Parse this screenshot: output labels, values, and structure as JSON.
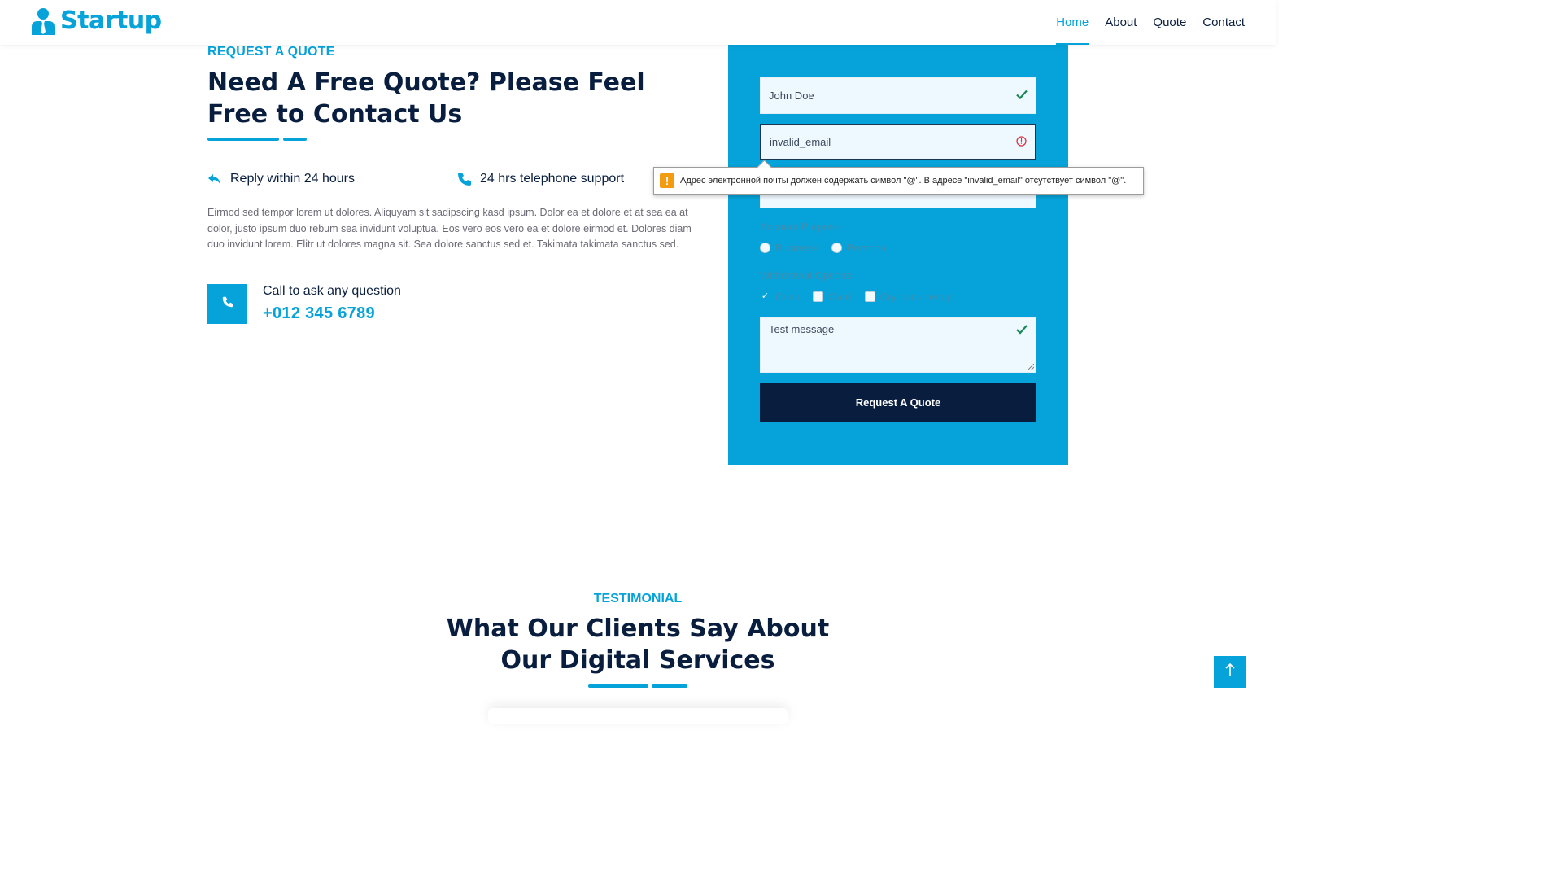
{
  "colors": {
    "primary": "#06a3da",
    "dark": "#091e3e",
    "form_bg": "#06a3da",
    "warning": "#f39c12",
    "valid": "#198754",
    "invalid": "#dc3545"
  },
  "brand": {
    "name": "Startup",
    "icon": "user-tie-icon"
  },
  "nav": {
    "items": [
      {
        "label": "Home",
        "active": true
      },
      {
        "label": "About",
        "active": false
      },
      {
        "label": "Quote",
        "active": false
      },
      {
        "label": "Contact",
        "active": false
      }
    ]
  },
  "quote": {
    "subtitle": "REQUEST A QUOTE",
    "heading": "Need A Free Quote? Please Feel Free to Contact Us",
    "features": [
      {
        "icon": "reply-icon",
        "label": "Reply within 24 hours"
      },
      {
        "icon": "phone-icon",
        "label": "24 hrs telephone support"
      }
    ],
    "paragraph": "Eirmod sed tempor lorem ut dolores. Aliquyam sit sadipscing kasd ipsum. Dolor ea et dolore et at sea ea at dolor, justo ipsum duo rebum sea invidunt voluptua. Eos vero eos vero ea et dolore eirmod et. Dolores diam duo invidunt lorem. Elitr ut dolores magna sit. Sea dolore sanctus sed et. Takimata takimata sanctus sed.",
    "call": {
      "label": "Call to ask any question",
      "number": "+012 345 6789",
      "icon": "phone-icon"
    }
  },
  "form": {
    "name_value": "John Doe",
    "email_value": "invalid_email",
    "account_purpose_label": "Account Purpose:",
    "account_options": [
      "Business",
      "Personal"
    ],
    "withdrawal_label": "Withdrawal Options:",
    "withdrawal_options": [
      {
        "label": "Cash",
        "checked": true
      },
      {
        "label": "Card",
        "checked": false
      },
      {
        "label": "Cryptocurrency",
        "checked": false
      }
    ],
    "message_value": "Test message",
    "submit_label": "Request A Quote"
  },
  "tooltip": {
    "text": "Адрес электронной почты должен содержать символ \"@\". В адресе \"invalid_email\" отсутствует символ \"@\"."
  },
  "testimonial": {
    "subtitle": "TESTIMONIAL",
    "heading_line1": "What Our Clients Say About",
    "heading_line2": "Our Digital Services"
  },
  "back_to_top": {
    "icon": "arrow-up-icon"
  }
}
